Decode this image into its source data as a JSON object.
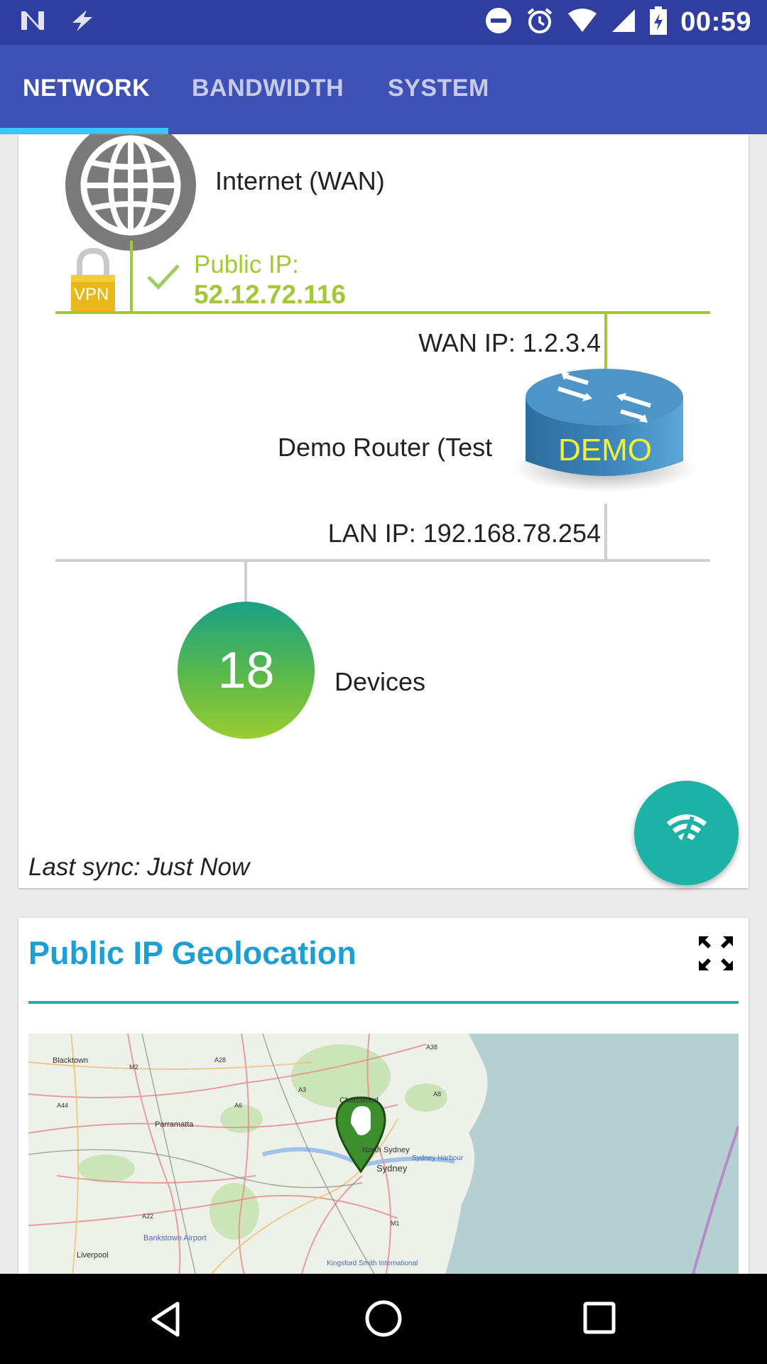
{
  "status_bar": {
    "time": "00:59",
    "icons": [
      "n-notification-icon",
      "flash-icon",
      "dnd-icon",
      "alarm-icon",
      "wifi-icon",
      "cell-signal-icon",
      "battery-charging-icon"
    ]
  },
  "tabs": [
    {
      "label": "NETWORK",
      "active": true
    },
    {
      "label": "BANDWIDTH",
      "active": false
    },
    {
      "label": "SYSTEM",
      "active": false
    }
  ],
  "network": {
    "internet_label": "Internet (WAN)",
    "vpn_badge": "VPN",
    "public_ip_label": "Public IP:",
    "public_ip_value": "52.12.72.116",
    "wan_ip": "WAN IP: 1.2.3.4",
    "router_name": "Demo Router (Test",
    "router_badge": "DEMO",
    "lan_ip": "LAN IP: 192.168.78.254",
    "devices_count": "18",
    "devices_label": "Devices",
    "last_sync": "Last sync: Just Now"
  },
  "geolocation": {
    "title": "Public IP Geolocation",
    "map_labels": [
      {
        "text": "Blacktown"
      },
      {
        "text": "Parramatta"
      },
      {
        "text": "Chatswood"
      },
      {
        "text": "North Sydney"
      },
      {
        "text": "Sydney"
      },
      {
        "text": "Liverpool"
      },
      {
        "text": "Bankstown Airport"
      },
      {
        "text": "Kingsford Smith International"
      },
      {
        "text": "Sydney Harbour"
      },
      {
        "text": "M2"
      },
      {
        "text": "A28"
      },
      {
        "text": "A44"
      },
      {
        "text": "A6"
      },
      {
        "text": "A3"
      },
      {
        "text": "A22"
      },
      {
        "text": "M1"
      },
      {
        "text": "A38"
      },
      {
        "text": "A8"
      }
    ]
  },
  "colors": {
    "status_bar": "#303f9f",
    "tab_bar": "#3f51b5",
    "tab_indicator": "#40c4ff",
    "wan_green": "#a4c639",
    "teal": "#1eb2a6",
    "title_blue": "#1e9fd3"
  }
}
